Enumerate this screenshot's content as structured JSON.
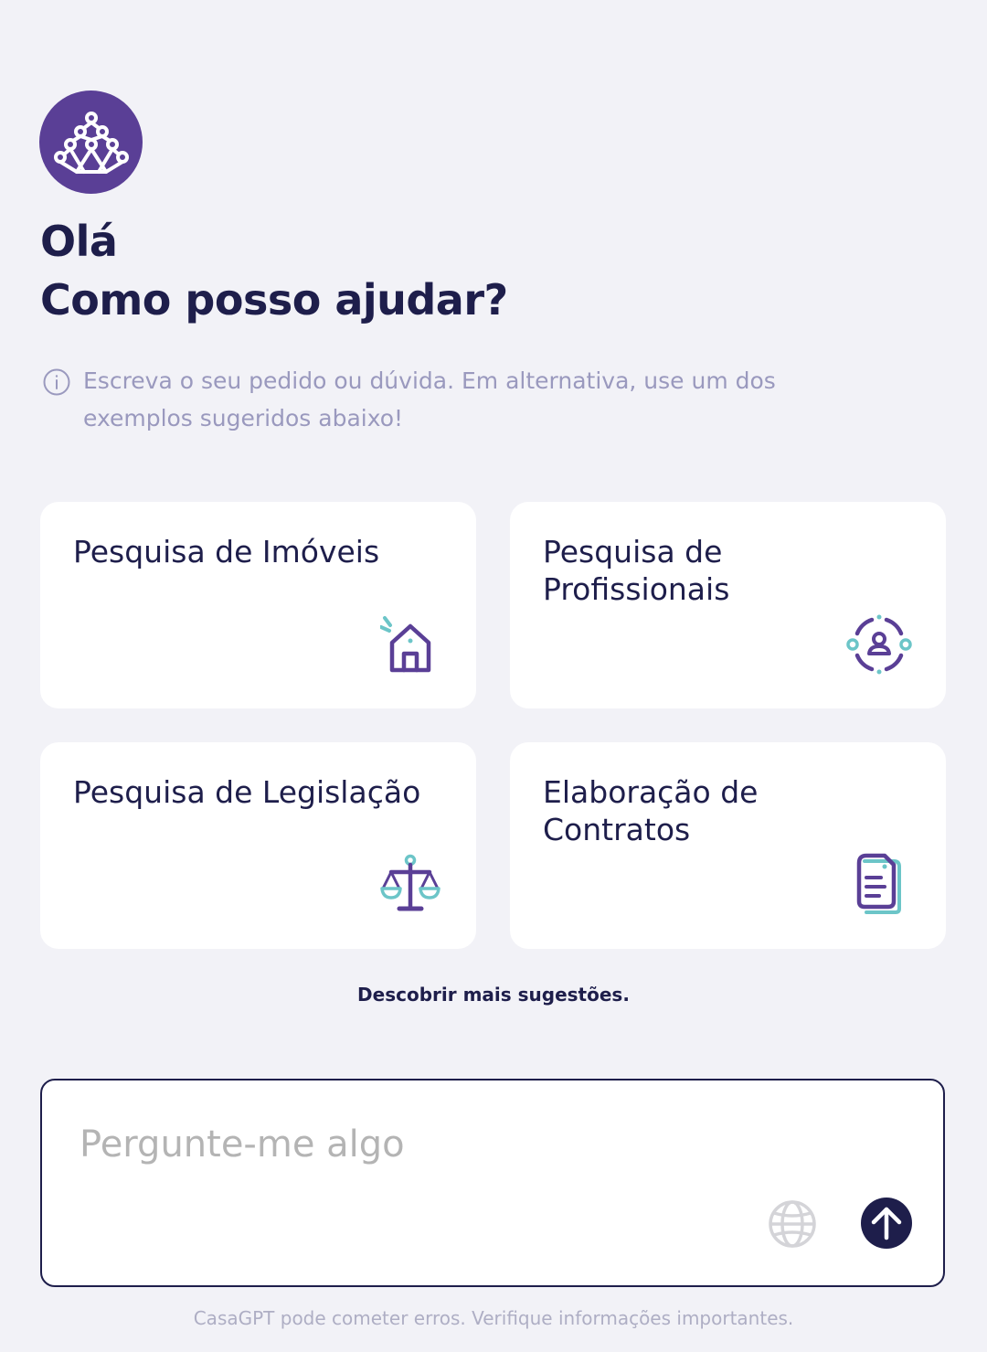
{
  "greeting": {
    "line1": "Olá",
    "line2": "Como posso ajudar?"
  },
  "info": {
    "icon": "info-icon",
    "text": "Escreva o seu pedido ou dúvida. Em alternativa, use um dos exemplos sugeridos abaixo!"
  },
  "suggestions": [
    {
      "title": "Pesquisa de Imóveis",
      "icon": "house-icon"
    },
    {
      "title": "Pesquisa de Profissionais",
      "icon": "professional-search-icon"
    },
    {
      "title": "Pesquisa de Legislação",
      "icon": "scales-icon"
    },
    {
      "title": "Elaboração de Contratos",
      "icon": "contract-document-icon"
    }
  ],
  "more_suggestions": "Descobrir mais sugestões.",
  "input": {
    "placeholder": "Pergunte-me algo",
    "value": ""
  },
  "actions": {
    "web_search_icon": "globe-icon",
    "send_icon": "arrow-up-icon"
  },
  "disclaimer": "CasaGPT pode cometer erros. Verifique informações importantes.",
  "colors": {
    "primary": "#1e1e4b",
    "accent": "#5a3f96",
    "teal": "#6cc5c8",
    "background": "#f2f2f7",
    "muted": "#9a99be"
  }
}
